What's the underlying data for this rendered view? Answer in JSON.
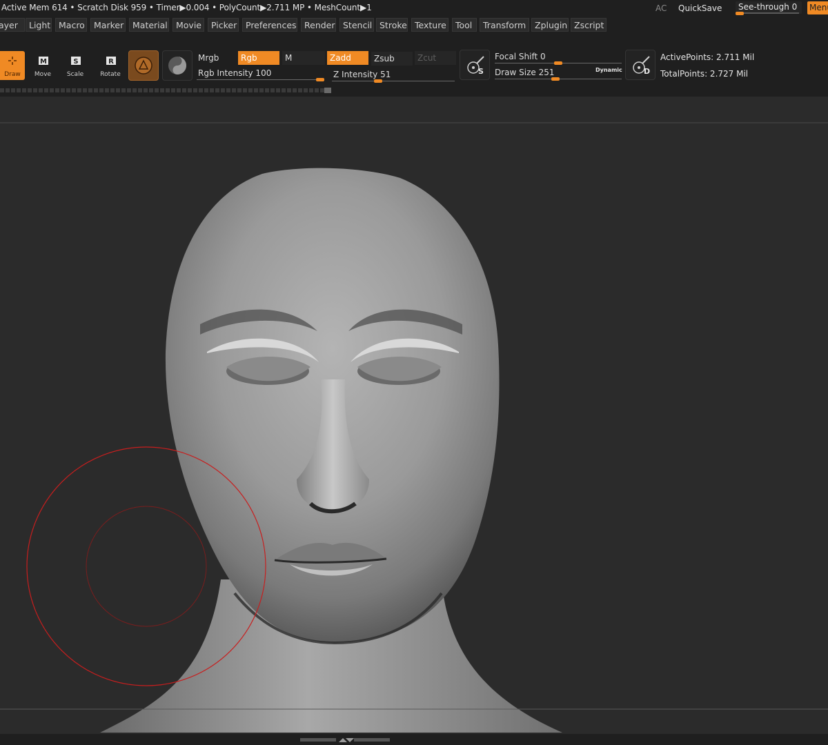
{
  "status": {
    "text": "Active Mem 614 • Scratch Disk 959 •  Timer▶0.004 • PolyCount▶2.711 MP  • MeshCount▶1",
    "ac_label": "AC",
    "quicksave_label": "QuickSave",
    "seethrough_label": "See-through  0",
    "seethrough_value": 0,
    "menu_button_label": "Menus"
  },
  "menu": {
    "items": [
      "Layer",
      "Light",
      "Macro",
      "Marker",
      "Material",
      "Movie",
      "Picker",
      "Preferences",
      "Render",
      "Stencil",
      "Stroke",
      "Texture",
      "Tool",
      "Transform",
      "Zplugin",
      "Zscript"
    ]
  },
  "toolbar": {
    "tools": [
      {
        "name": "draw-tool-button",
        "label": "Draw",
        "active": true,
        "glyph": "✛"
      },
      {
        "name": "move-tool-button",
        "label": "Move",
        "active": false,
        "glyph": "M"
      },
      {
        "name": "scale-tool-button",
        "label": "Scale",
        "active": false,
        "glyph": "S"
      },
      {
        "name": "rotate-tool-button",
        "label": "Rotate",
        "active": false,
        "glyph": "R"
      }
    ],
    "mrgb_label": "Mrgb",
    "rgb_label": "Rgb",
    "m_label": "M",
    "rgb_intensity_label": "Rgb Intensity 100",
    "rgb_intensity_value": 100,
    "zadd_label": "Zadd",
    "zsub_label": "Zsub",
    "zcut_label": "Zcut",
    "z_intensity_label": "Z Intensity 51",
    "z_intensity_value": 51,
    "lazy_s_label": "S",
    "focal_shift_label": "Focal Shift 0",
    "focal_shift_value": 0,
    "draw_size_label": "Draw Size 251",
    "draw_size_value": 251,
    "dynamic_label": "Dynamic",
    "dynamic_d_label": "D",
    "active_points_label": "ActivePoints: 2.711 Mil",
    "total_points_label": "TotalPoints: 2.727 Mil"
  },
  "colors": {
    "accent": "#f08a24",
    "bar": "#1f1f1f",
    "canvas": "#2b2b2b",
    "brush_cursor": "#c81e1e"
  }
}
